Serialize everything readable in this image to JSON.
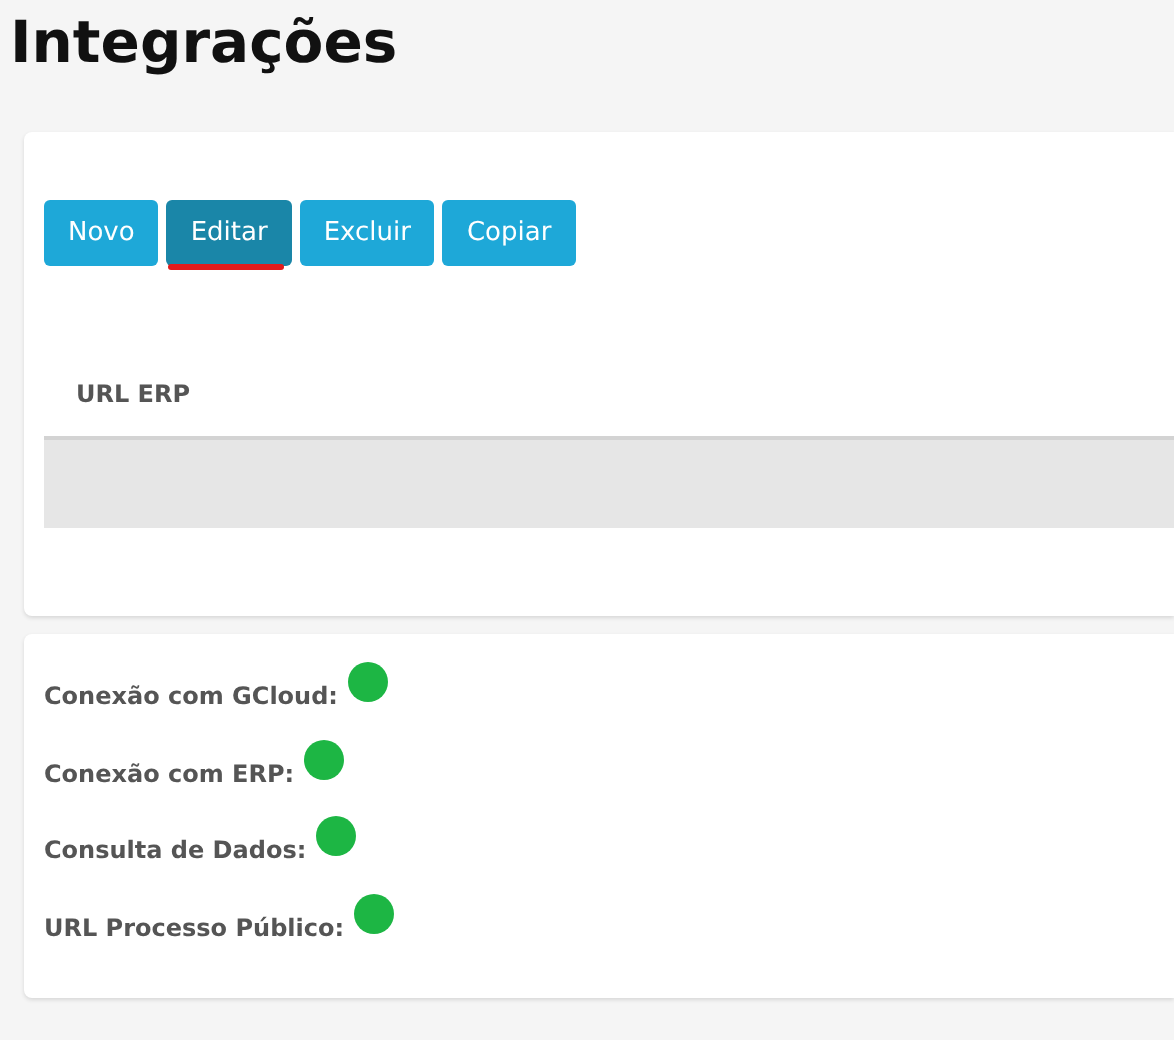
{
  "page": {
    "title": "Integrações"
  },
  "toolbar": {
    "buttons": [
      {
        "label": "Novo",
        "selected": false
      },
      {
        "label": "Editar",
        "selected": true
      },
      {
        "label": "Excluir",
        "selected": false
      },
      {
        "label": "Copiar",
        "selected": false
      }
    ]
  },
  "table": {
    "columns": [
      "URL ERP"
    ],
    "rows": [
      {
        "url_erp": ""
      }
    ]
  },
  "status": [
    {
      "label": "Conexão com GCloud:",
      "color": "#1db644"
    },
    {
      "label": "Conexão com ERP:",
      "color": "#1db644"
    },
    {
      "label": "Consulta de Dados:",
      "color": "#1db644"
    },
    {
      "label": "URL Processo Público:",
      "color": "#1db644"
    }
  ]
}
